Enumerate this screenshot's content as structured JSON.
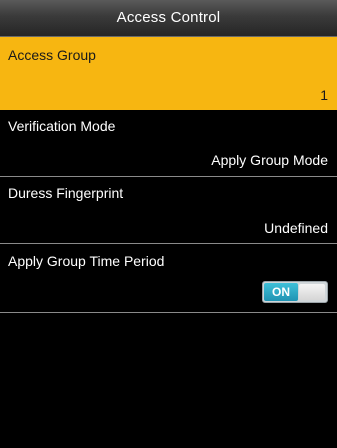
{
  "header": {
    "title": "Access Control"
  },
  "items": [
    {
      "label": "Access Group",
      "value": "1",
      "selected": true
    },
    {
      "label": "Verification Mode",
      "value": "Apply Group Mode"
    },
    {
      "label": "Duress Fingerprint",
      "value": "Undefined"
    },
    {
      "label": "Apply Group Time Period",
      "toggle": "ON",
      "toggle_state": true
    }
  ],
  "colors": {
    "selected_bg": "#f7b611",
    "toggle_on": "#1f93b3",
    "background": "#000000"
  }
}
